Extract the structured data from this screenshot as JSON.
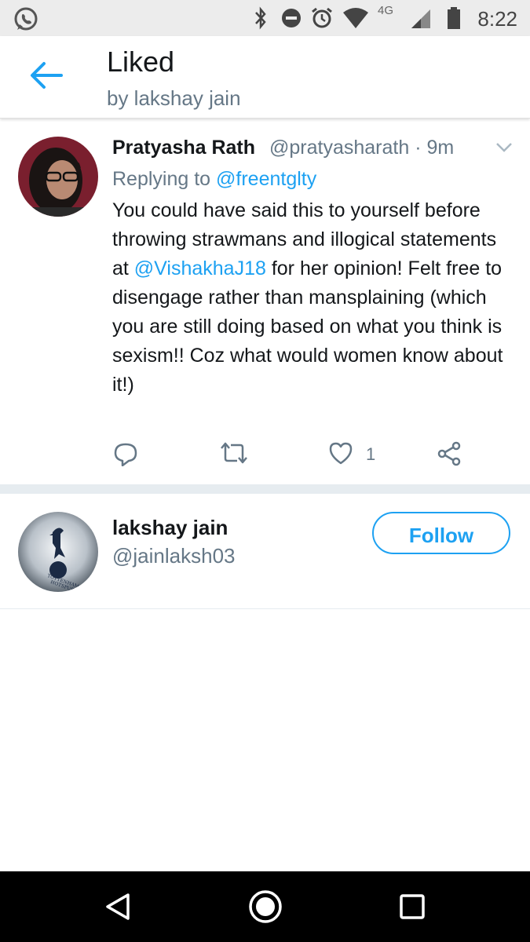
{
  "status_bar": {
    "time": "8:22",
    "network": "4G",
    "icons": [
      "whatsapp-icon",
      "bluetooth-icon",
      "do-not-disturb-icon",
      "alarm-icon",
      "wifi-icon",
      "signal-icon",
      "battery-icon"
    ]
  },
  "header": {
    "back_icon": "back-arrow-icon",
    "title": "Liked",
    "subtitle": "by lakshay jain"
  },
  "tweet": {
    "author_name": "Pratyasha Rath",
    "author_handle_time": "@pratyasharath · 9m",
    "reply_prefix": "Replying to ",
    "reply_to": "@freentglty",
    "text_before_mention": "You could have said this to yourself before throwing strawmans and illogical statements at ",
    "mention": "@VishakhaJ18",
    "text_after_mention": " for her opinion! Felt free to disengage rather than mansplaining (which you are still doing based on what you think is sexism!! Coz what would women know about it!)",
    "like_count": "1",
    "actions": [
      "reply-icon",
      "retweet-icon",
      "like-icon",
      "share-icon"
    ]
  },
  "user": {
    "name": "lakshay jain",
    "handle": "@jainlaksh03",
    "follow_label": "Follow",
    "avatar_logo_text": "TOTTENHAM HOTSPUR"
  },
  "nav": {
    "buttons": [
      "back-nav-icon",
      "home-nav-icon",
      "recents-nav-icon"
    ]
  },
  "colors": {
    "accent": "#1da1f2",
    "secondary_text": "#657786",
    "primary_text": "#14171a",
    "status_bar_bg": "#ececec",
    "nav_bar_bg": "#000000"
  }
}
